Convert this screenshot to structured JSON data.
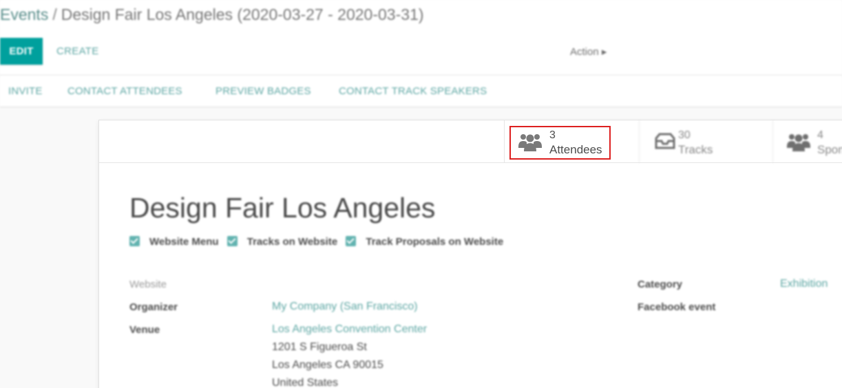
{
  "breadcrumb": {
    "parent": "Events",
    "separator": "/",
    "current": "Design Fair Los Angeles (2020-03-27 - 2020-03-31)"
  },
  "toolbar": {
    "edit_label": "EDIT",
    "create_label": "CREATE",
    "action_label": "Action ▸"
  },
  "header_buttons": [
    {
      "label": "INVITE"
    },
    {
      "label": "CONTACT ATTENDEES"
    },
    {
      "label": "PREVIEW BADGES"
    },
    {
      "label": "CONTACT TRACK SPEAKERS"
    }
  ],
  "stat_buttons": [
    {
      "value": "3",
      "label": "Attendees",
      "icon": "users-icon"
    },
    {
      "value": "30",
      "label": "Tracks",
      "icon": "inbox-icon"
    },
    {
      "value": "4",
      "label": "Spon",
      "icon": "users-icon"
    }
  ],
  "event": {
    "title": "Design Fair Los Angeles",
    "options": [
      {
        "label": "Website Menu",
        "checked": true
      },
      {
        "label": "Tracks on Website",
        "checked": true
      },
      {
        "label": "Track Proposals on Website",
        "checked": true
      }
    ]
  },
  "fields": {
    "website_label": "Website",
    "organizer_label": "Organizer",
    "organizer_value": "My Company (San Francisco)",
    "venue_label": "Venue",
    "venue_name": "Los Angeles Convention Center",
    "venue_street": "1201 S Figueroa St",
    "venue_city": "Los Angeles CA 90015",
    "venue_country": "United States",
    "category_label": "Category",
    "category_value": "Exhibition",
    "facebook_label": "Facebook event"
  },
  "colors": {
    "primary": "#00a09d",
    "link": "#5ea7a4",
    "highlight": "#dd1f1f"
  }
}
